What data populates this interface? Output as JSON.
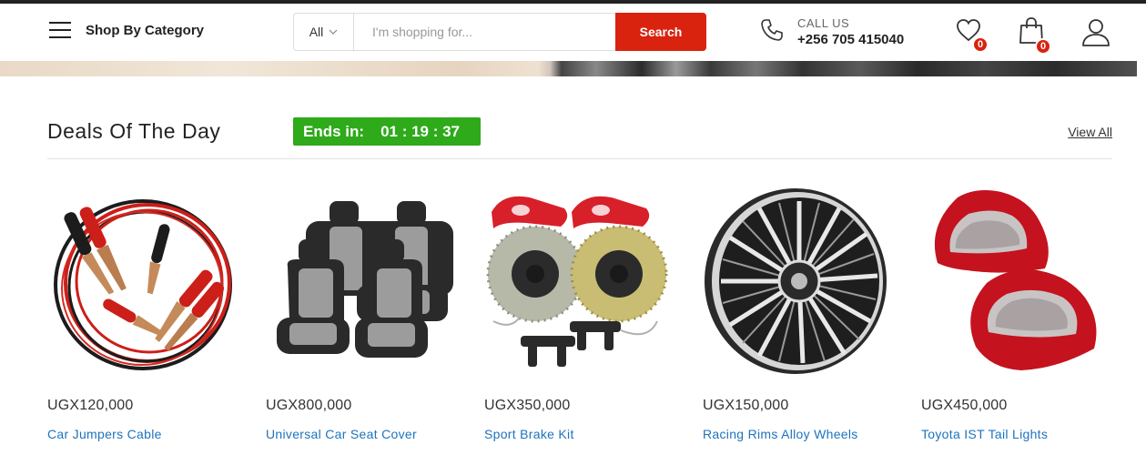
{
  "header": {
    "category_label": "Shop By Category",
    "search": {
      "category_selected": "All",
      "placeholder": "I'm shopping for...",
      "value": "",
      "button_label": "Search"
    },
    "call": {
      "label": "CALL US",
      "phone": "+256 705 415040"
    },
    "wishlist_count": "0",
    "cart_count": "0"
  },
  "deals": {
    "title": "Deals Of The Day",
    "ends_label": "Ends in:",
    "countdown": "01 : 19 : 37",
    "view_all": "View All",
    "products": [
      {
        "price": "UGX120,000",
        "name": "Car Jumpers Cable",
        "icon": "jumper-cable-image"
      },
      {
        "price": "UGX800,000",
        "name": "Universal Car Seat Cover",
        "icon": "seat-cover-image"
      },
      {
        "price": "UGX350,000",
        "name": "Sport Brake Kit",
        "icon": "brake-kit-image"
      },
      {
        "price": "UGX150,000",
        "name": "Racing Rims Alloy Wheels",
        "icon": "alloy-wheel-image"
      },
      {
        "price": "UGX450,000",
        "name": "Toyota IST Tail Lights",
        "icon": "tail-lights-image"
      }
    ]
  },
  "colors": {
    "accent_red": "#d9230f",
    "countdown_green": "#2eaa1a",
    "link_blue": "#1e73be"
  }
}
